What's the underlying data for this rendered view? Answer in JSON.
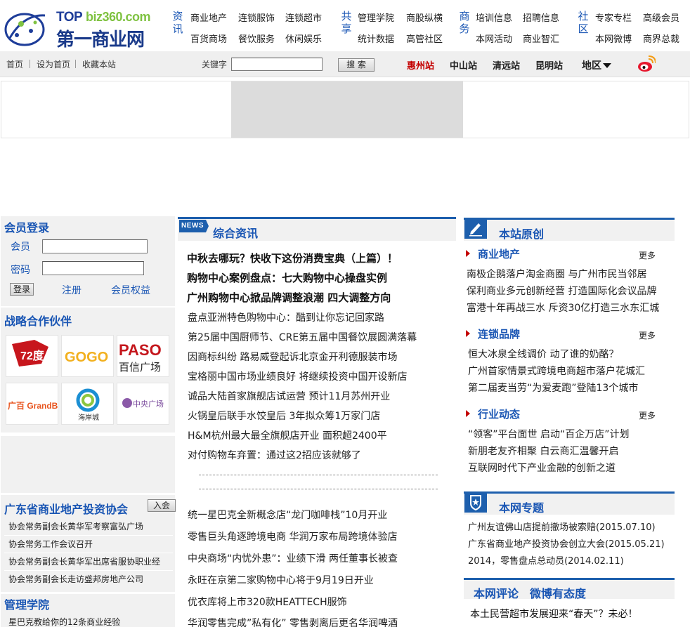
{
  "logo": {
    "top_text": "TOP",
    "domain_text": "biz360.com",
    "name": "第一商业网"
  },
  "nav_groups": [
    {
      "title": "资讯",
      "links": [
        "商业地产",
        "连锁服饰",
        "连锁超市",
        "百货商场",
        "餐饮服务",
        "休闲娱乐"
      ]
    },
    {
      "title": "共享",
      "links": [
        "管理学院",
        "商股纵横",
        "统计数据",
        "高管社区"
      ]
    },
    {
      "title": "商务",
      "links": [
        "培训信息",
        "招聘信息",
        "本网活动",
        "商业智汇"
      ]
    },
    {
      "title": "社区",
      "links": [
        "专家专栏",
        "高级会员",
        "本网微博",
        "商界总裁"
      ]
    }
  ],
  "subbar": {
    "links": [
      "首页",
      "设为首页",
      "收藏本站"
    ],
    "keyword_label": "关键字",
    "search_placeholder": "",
    "search_button": "搜 索",
    "stations": [
      "惠州站",
      "中山站",
      "清远站",
      "昆明站",
      "地区"
    ]
  },
  "colors": {
    "brand_blue": "#1d5fad",
    "link_blue": "#1a56b4",
    "accent_red": "#c40000",
    "panel_gray": "#f1f1f1"
  },
  "login": {
    "title": "会员登录",
    "member_label": "会员",
    "password_label": "密码",
    "login_button": "登录",
    "register_link": "注册",
    "benefits_link": "会员权益"
  },
  "partners": {
    "title": "战略合作伙伴",
    "logos": [
      "72度",
      "GOGO",
      "PASO百信广场",
      "广百GrandBuy",
      "海岸城",
      "中央广场"
    ]
  },
  "association": {
    "title": "广东省商业地产投资协会",
    "join_button": "入会",
    "items": [
      "协会常务副会长黄华军考察富弘广场",
      "协会常务工作会议召开",
      "协会常务副会长黄华军出席省服协职业经",
      "协会常务副会长走访盛邦房地产公司"
    ]
  },
  "academy": {
    "title": "管理学院",
    "items": [
      "星巴克教给你的12条商业经验"
    ]
  },
  "center": {
    "tag": "NEWS",
    "title": "综合资讯",
    "headlines": [
      "中秋去哪玩？快收下这份消费宝典（上篇）！",
      "购物中心案例盘点：七大购物中心操盘实例",
      "广州购物中心掀品牌调整浪潮 四大调整方向"
    ],
    "items": [
      "盘点亚洲特色购物中心：酷到让你忘记回家路",
      "第25届中国厨师节、CRE第五届中国餐饮展圆满落幕",
      "因商标纠纷 路易威登起诉北京金开利德服装市场",
      "宝格丽中国市场业绩良好 将继续投资中国开设新店",
      "诚品大陆首家旗舰店试运营 预计11月苏州开业",
      "火锅皇后联手水饺皇后 3年拟众筹1万家门店",
      "H&M杭州最大最全旗舰店开业 面积超2400平",
      "对付购物车弃置：通过这2招应该就够了"
    ],
    "items2": [
      "统一星巴克全新概念店“龙门咖啡栈”10月开业",
      "零售巨头角逐跨境电商 华润万家布局跨境体验店",
      "中央商场“内忧外患”：业绩下滑 两任董事长被查",
      "永旺在京第二家购物中心将于9月19日开业",
      "优衣库将上市320款HEATTECH服饰",
      "华润零售完成”私有化” 零售剥离后更名华润啤酒"
    ]
  },
  "right": {
    "original_title": "本站原创",
    "more_label": "更多",
    "sections": [
      {
        "title": "商业地产",
        "items": [
          "南极企鹅落户淘金商圈 与广州市民当邻居",
          "保利商业多元创新经营 打造国际化会议品牌",
          "富港十年再战三水 斥资30亿打造三水东汇城"
        ]
      },
      {
        "title": "连锁品牌",
        "items": [
          "恒大冰泉全线调价 动了谁的奶酪？",
          "广州首家情景式跨境电商超市落户花城汇",
          "第二届麦当劳“为爱麦跑”登陆13个城市"
        ]
      },
      {
        "title": "行业动态",
        "items": [
          "“领客”平台面世 启动“百企万店”计划",
          "新朋老友齐相聚 白云商汇温馨开启",
          "互联网时代下产业金融的创新之道"
        ]
      }
    ],
    "topic_title": "本网专题",
    "topics": [
      "广州友谊佛山店提前撤场被索赔(2015.07.10)",
      "广东省商业地产投资协会创立大会(2015.05.21)",
      "2014，零售盘点总动员(2014.02.11)"
    ],
    "comment_tabs": [
      "本网评论",
      "微博有态度"
    ],
    "comments": [
      "本土民营超市发展迎来“春天”？未必！"
    ]
  }
}
